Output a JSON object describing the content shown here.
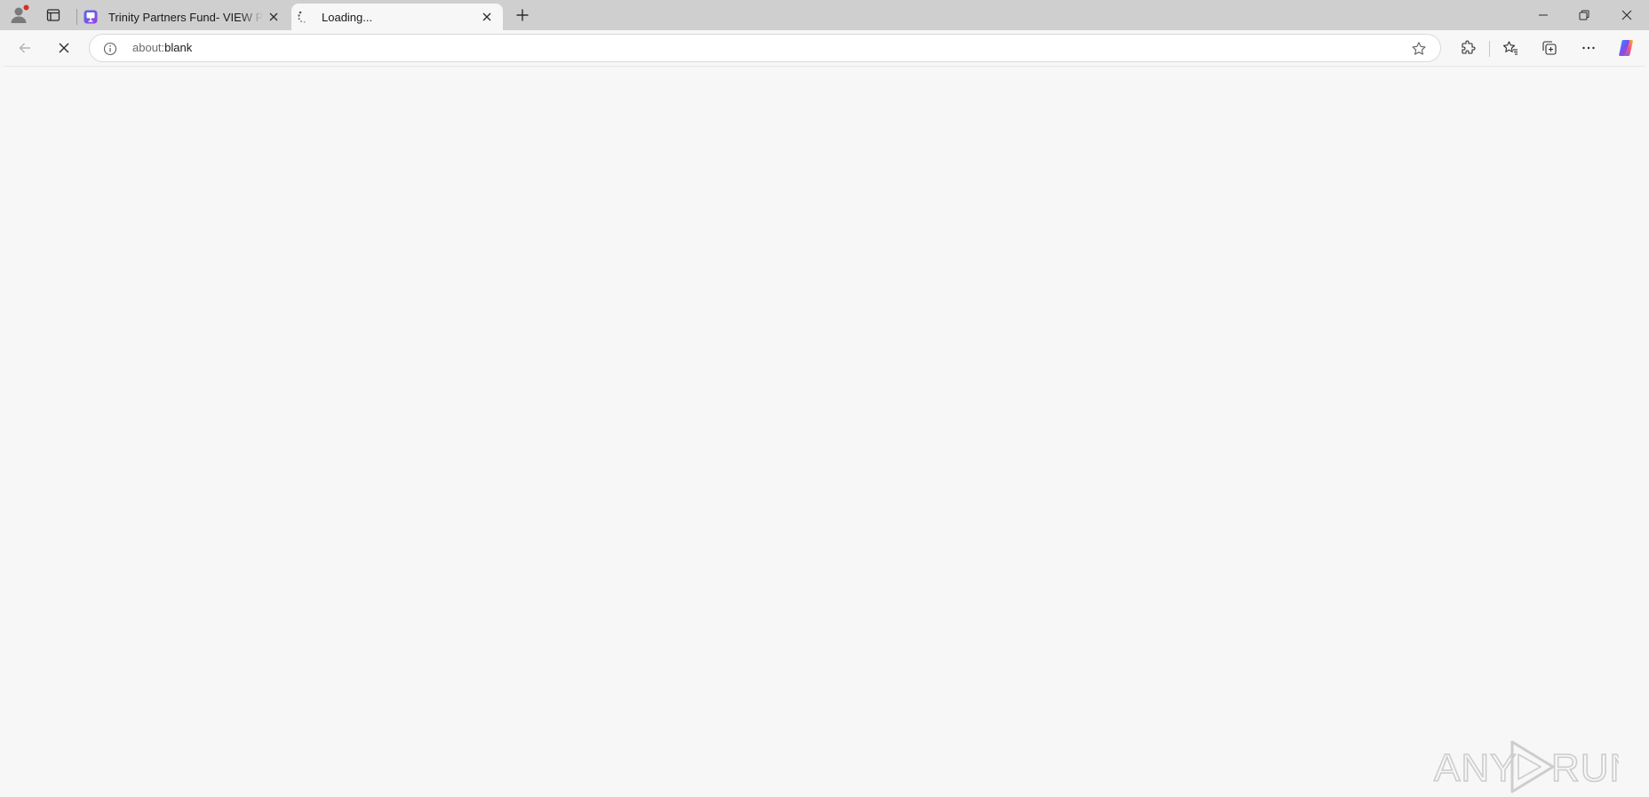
{
  "tabs": [
    {
      "title": "Trinity Partners Fund- VIEW PRESENTATION",
      "active": false,
      "favicon": "presentation-favicon"
    },
    {
      "title": "Loading...",
      "active": true,
      "favicon": "loading-spinner"
    }
  ],
  "address_bar": {
    "scheme": "about:",
    "rest": "blank"
  },
  "watermark": {
    "text_left": "ANY",
    "text_right": "RUN"
  },
  "colors": {
    "tabstrip_bg": "#cfcfcf",
    "page_bg": "#f7f7f7",
    "profile_dot": "#d92b2b"
  },
  "icons": [
    "profile-icon",
    "tab-actions-icon",
    "close-icon",
    "new-tab-icon",
    "minimize-icon",
    "restore-icon",
    "back-arrow-icon",
    "stop-icon",
    "info-icon",
    "star-icon",
    "extensions-icon",
    "favorites-icon",
    "collections-icon",
    "more-icon",
    "copilot-icon"
  ]
}
